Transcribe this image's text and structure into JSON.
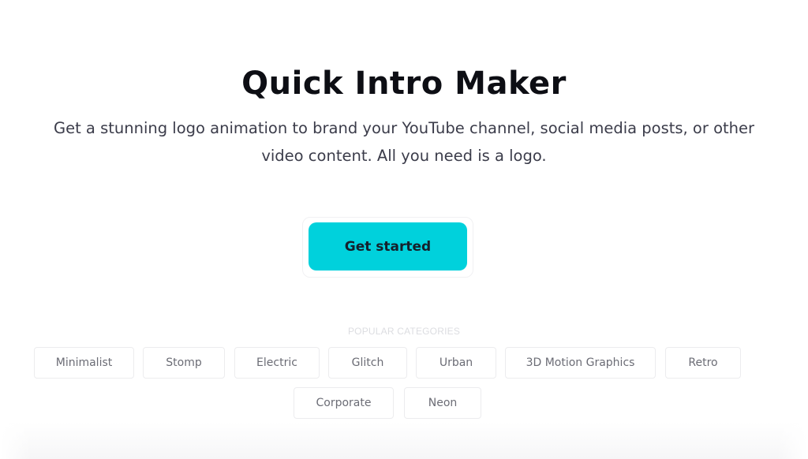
{
  "hero": {
    "title": "Quick Intro Maker",
    "subtitle_line1": "Get a stunning logo animation to brand your YouTube channel, social media posts, or other",
    "subtitle_line2": "video content. All you need is a logo.",
    "cta_label": "Get started",
    "cta_color": "#00d1dc"
  },
  "categories": {
    "label": "POPULAR CATEGORIES",
    "items": [
      {
        "label": "Minimalist"
      },
      {
        "label": "Stomp"
      },
      {
        "label": "Electric"
      },
      {
        "label": "Glitch"
      },
      {
        "label": "Urban"
      },
      {
        "label": "3D Motion Graphics"
      },
      {
        "label": "Retro"
      },
      {
        "label": "Corporate"
      },
      {
        "label": "Neon"
      }
    ]
  }
}
